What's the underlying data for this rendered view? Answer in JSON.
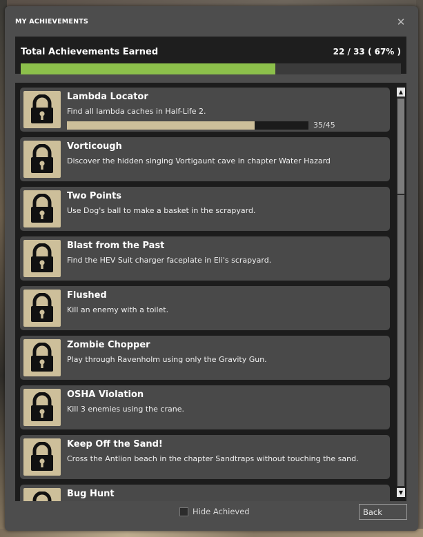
{
  "dialog": {
    "title": "MY ACHIEVEMENTS",
    "close_icon": "close-icon"
  },
  "summary": {
    "label": "Total Achievements Earned",
    "count_text": "22 / 33 ( 67% )",
    "progress_fraction": 0.67,
    "bar_color": "#8cc04b"
  },
  "achievements": [
    {
      "name": "Lambda Locator",
      "description": "Find all lambda caches in Half-Life 2.",
      "progress_text": "35/45",
      "progress_fraction": 0.778,
      "icon": "padlock-icon"
    },
    {
      "name": "Vorticough",
      "description": "Discover the hidden singing Vortigaunt cave in chapter Water Hazard",
      "icon": "padlock-icon"
    },
    {
      "name": "Two Points",
      "description": "Use Dog's ball to make a basket in the scrapyard.",
      "icon": "padlock-icon"
    },
    {
      "name": "Blast from the Past",
      "description": "Find the HEV Suit charger faceplate in Eli's scrapyard.",
      "icon": "padlock-icon"
    },
    {
      "name": "Flushed",
      "description": "Kill an enemy with a toilet.",
      "icon": "padlock-icon"
    },
    {
      "name": "Zombie Chopper",
      "description": "Play through Ravenholm using only the Gravity Gun.",
      "icon": "padlock-icon"
    },
    {
      "name": "OSHA Violation",
      "description": "Kill 3 enemies using the crane.",
      "icon": "padlock-icon"
    },
    {
      "name": "Keep Off the Sand!",
      "description": "Cross the Antlion beach in the chapter Sandtraps without touching the sand.",
      "icon": "padlock-icon"
    },
    {
      "name": "Bug Hunt",
      "description": "",
      "icon": "padlock-icon"
    }
  ],
  "footer": {
    "hide_achieved_label": "Hide Achieved",
    "hide_achieved_checked": false,
    "back_label": "Back"
  },
  "colors": {
    "locked_icon_bg": "#cdbf9a",
    "row_bg": "#494949",
    "dialog_bg": "#4d4d4d"
  }
}
